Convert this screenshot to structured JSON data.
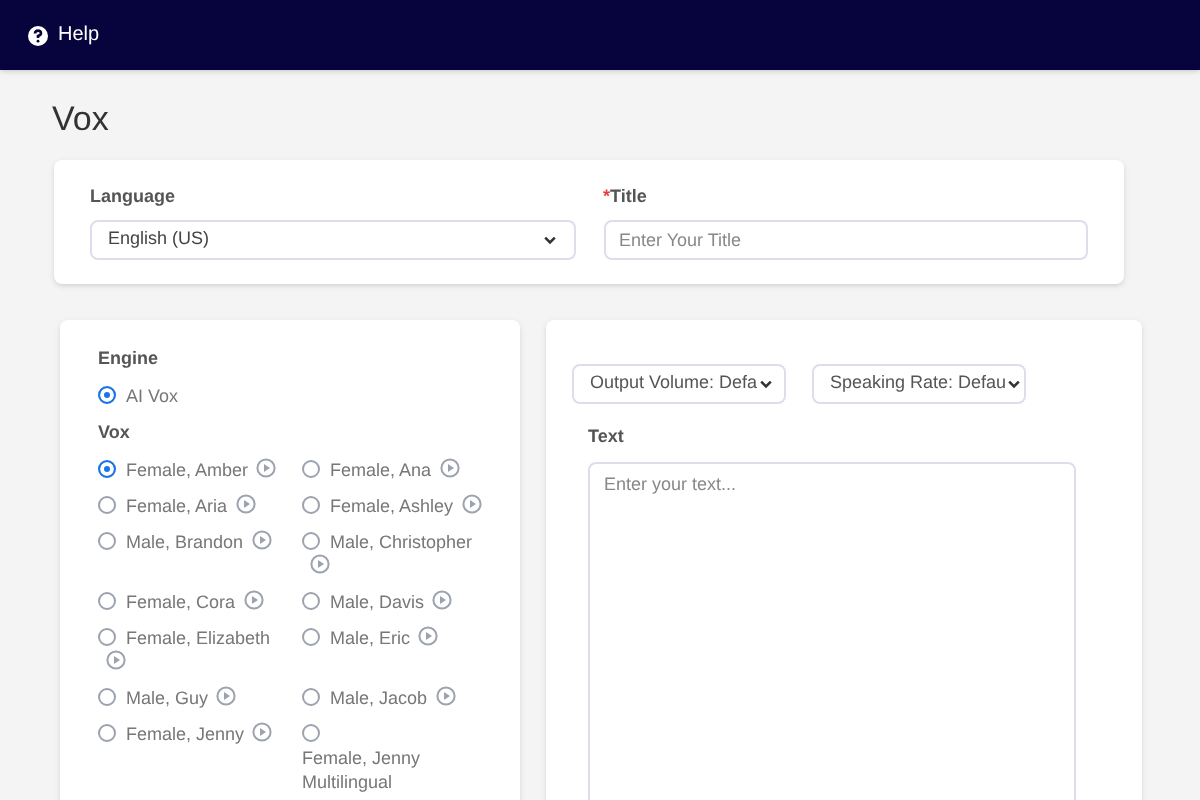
{
  "navbar": {
    "help_label": "Help"
  },
  "page_title": "Vox",
  "settings": {
    "language_label": "Language",
    "language_value": "English (US)",
    "title_required_mark": "*",
    "title_label": "Title",
    "title_placeholder": "Enter Your Title"
  },
  "engine": {
    "label": "Engine",
    "options": [
      {
        "label": "AI Vox",
        "selected": true
      }
    ]
  },
  "vox": {
    "label": "Vox",
    "voices": [
      {
        "label": "Female, Amber",
        "selected": true,
        "has_play": true
      },
      {
        "label": "Female, Ana",
        "selected": false,
        "has_play": true
      },
      {
        "label": "Female, Aria",
        "selected": false,
        "has_play": true
      },
      {
        "label": "Female, Ashley",
        "selected": false,
        "has_play": true
      },
      {
        "label": "Male, Brandon",
        "selected": false,
        "has_play": true
      },
      {
        "label": "Male, Christopher",
        "selected": false,
        "has_play": true
      },
      {
        "label": "Female, Cora",
        "selected": false,
        "has_play": true
      },
      {
        "label": "Male, Davis",
        "selected": false,
        "has_play": true
      },
      {
        "label": "Female, Elizabeth",
        "selected": false,
        "has_play": true
      },
      {
        "label": "Male, Eric",
        "selected": false,
        "has_play": true
      },
      {
        "label": "Male, Guy",
        "selected": false,
        "has_play": true
      },
      {
        "label": "Male, Jacob",
        "selected": false,
        "has_play": true
      },
      {
        "label": "Female, Jenny",
        "selected": false,
        "has_play": true
      },
      {
        "label": "Female, Jenny Multilingual",
        "selected": false,
        "has_play": false
      }
    ]
  },
  "output_volume": "Output Volume: Defa",
  "speaking_rate": "Speaking Rate: Defau",
  "text": {
    "label": "Text",
    "placeholder": "Enter your text..."
  }
}
